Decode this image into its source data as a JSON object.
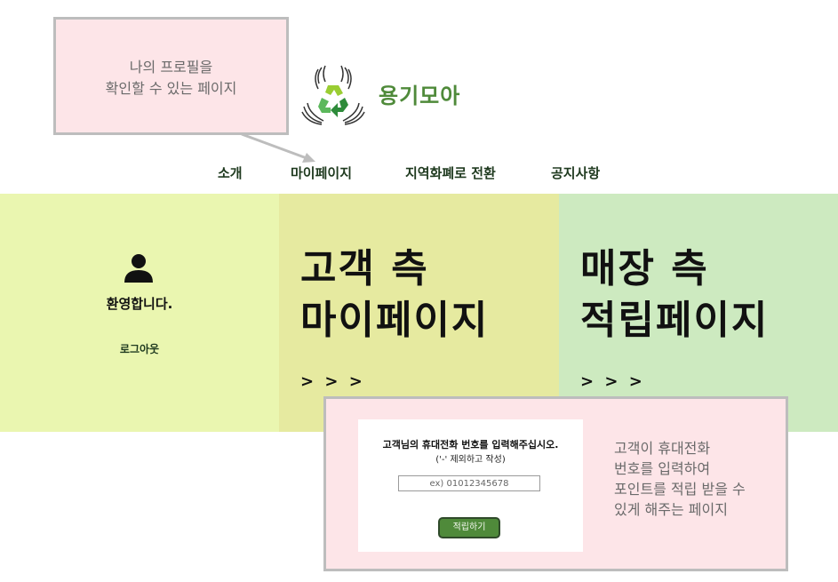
{
  "brand": {
    "name": "용기모아",
    "logo_icon": "recycle-hands-icon",
    "color": "#4f8a3a"
  },
  "nav": {
    "items": [
      {
        "label": "소개"
      },
      {
        "label": "마이페이지"
      },
      {
        "label": "지역화폐로 전환"
      },
      {
        "label": "공지사항"
      }
    ]
  },
  "user_panel": {
    "icon": "user-icon",
    "welcome": "환영합니다.",
    "logout": "로그아웃",
    "bg": "#eaf6b0"
  },
  "customer_panel": {
    "title": "고객 측\n마이페이지",
    "arrows": "> > >",
    "bg": "#e6eaa0"
  },
  "store_panel": {
    "title": "매장 측\n적립페이지",
    "arrows": "> > >",
    "bg": "#cdeac0"
  },
  "notes": {
    "profile": "나의 프로필을\n확인할 수 있는 페이지",
    "points": "고객이 휴대전화\n번호를 입력하여\n포인트를 적립 받을 수\n있게 해주는 페이지"
  },
  "points_form": {
    "title": "고객님의 휴대전화 번호를 입력해주십시오.",
    "subtitle": "('-' 제외하고 작성)",
    "placeholder": "ex) 01012345678",
    "button": "적립하기"
  }
}
